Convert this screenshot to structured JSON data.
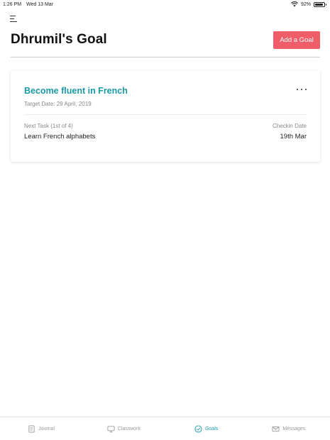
{
  "status_bar": {
    "time": "1:26 PM",
    "date": "Wed 13 Mar",
    "battery": "92%",
    "battery_level": 0.92
  },
  "header": {
    "title": "Dhrumil's Goal",
    "add_goal_label": "Add a Goal",
    "accent_color": "#ee5d68"
  },
  "goal_card": {
    "title": "Become fluent in French",
    "target_date": "Target Date: 29 April, 2019",
    "next_task_label": "Next Task (1st of 4)",
    "next_task": "Learn French alphabets",
    "checkin_label": "Checkin Date",
    "checkin_date": "19th Mar",
    "title_color": "#1a9ba8"
  },
  "tabs": [
    {
      "label": "Journal",
      "icon": "journal-icon",
      "active": false
    },
    {
      "label": "Classwork",
      "icon": "classwork-icon",
      "active": false
    },
    {
      "label": "Goals",
      "icon": "goals-icon",
      "active": true
    },
    {
      "label": "Messages",
      "icon": "messages-icon",
      "active": false
    }
  ]
}
